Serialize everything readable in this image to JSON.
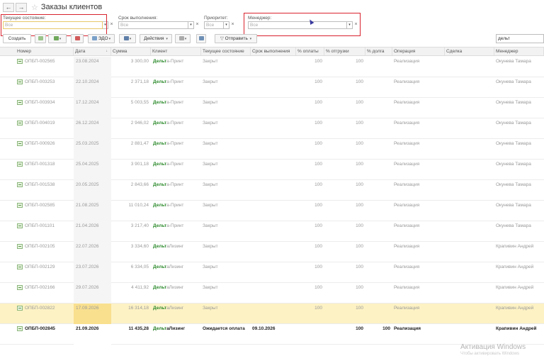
{
  "window": {
    "title": "Заказы клиентов",
    "back": "←",
    "forward": "→",
    "star": "☆"
  },
  "filters": {
    "state": {
      "label": "Текущее состояние:",
      "placeholder": "Все"
    },
    "due": {
      "label": "Срок выполнения:",
      "placeholder": "Все"
    },
    "priority": {
      "label": "Приоритет:",
      "placeholder": "Все"
    },
    "manager": {
      "label": "Менеджер:",
      "placeholder": "Все"
    },
    "clear": "×",
    "dropdown": "▾"
  },
  "toolbar": {
    "create": "Создать",
    "edo": "ЭДО",
    "actions": "Действия",
    "send": "Отправить",
    "search_value": "дельт",
    "caret": "▾"
  },
  "table": {
    "headers": [
      "Номер",
      "Дата",
      "Сумма",
      "Клиент",
      "Текущее состояние",
      "Срок выполнения",
      "% оплаты",
      "% отгрузки",
      "% долга",
      "Операция",
      "Сделка",
      "Менеджер"
    ],
    "sort_indicator": "↓",
    "rows": [
      {
        "number": "ОПБП-002565",
        "date": "23.08.2024",
        "sum": "3 300,00",
        "client_hl": "Дельт",
        "client_rest": "а-Принт",
        "state": "Закрыт",
        "due": "",
        "paid": "100",
        "shipped": "100",
        "debt": "",
        "operation": "Реализация",
        "deal": "",
        "manager": "Окунева Тамара"
      },
      {
        "number": "ОПБП-003253",
        "date": "22.10.2024",
        "sum": "2 371,18",
        "client_hl": "Дельт",
        "client_rest": "а-Принт",
        "state": "Закрыт",
        "due": "",
        "paid": "100",
        "shipped": "100",
        "debt": "",
        "operation": "Реализация",
        "deal": "",
        "manager": "Окунева Тамара"
      },
      {
        "number": "ОПБП-003934",
        "date": "17.12.2024",
        "sum": "5 003,55",
        "client_hl": "Дельт",
        "client_rest": "а-Принт",
        "state": "Закрыт",
        "due": "",
        "paid": "100",
        "shipped": "100",
        "debt": "",
        "operation": "Реализация",
        "deal": "",
        "manager": "Окунева Тамара"
      },
      {
        "number": "ОПБП-004019",
        "date": "26.12.2024",
        "sum": "2 946,02",
        "client_hl": "Дельт",
        "client_rest": "а-Принт",
        "state": "Закрыт",
        "due": "",
        "paid": "100",
        "shipped": "100",
        "debt": "",
        "operation": "Реализация",
        "deal": "",
        "manager": "Окунева Тамара"
      },
      {
        "number": "ОПБП-000926",
        "date": "25.03.2025",
        "sum": "2 881,47",
        "client_hl": "Дельт",
        "client_rest": "а-Принт",
        "state": "Закрыт",
        "due": "",
        "paid": "100",
        "shipped": "100",
        "debt": "",
        "operation": "Реализация",
        "deal": "",
        "manager": "Окунева Тамара"
      },
      {
        "number": "ОПБП-001318",
        "date": "25.04.2025",
        "sum": "3 901,18",
        "client_hl": "Дельт",
        "client_rest": "а-Принт",
        "state": "Закрыт",
        "due": "",
        "paid": "100",
        "shipped": "100",
        "debt": "",
        "operation": "Реализация",
        "deal": "",
        "manager": "Окунева Тамара"
      },
      {
        "number": "ОПБП-001538",
        "date": "20.05.2025",
        "sum": "2 843,66",
        "client_hl": "Дельт",
        "client_rest": "а-Принт",
        "state": "Закрыт",
        "due": "",
        "paid": "100",
        "shipped": "100",
        "debt": "",
        "operation": "Реализация",
        "deal": "",
        "manager": "Окунева Тамара"
      },
      {
        "number": "ОПБП-002585",
        "date": "21.08.2025",
        "sum": "11 010,24",
        "client_hl": "Дельт",
        "client_rest": "а-Принт",
        "state": "Закрыт",
        "due": "",
        "paid": "100",
        "shipped": "100",
        "debt": "",
        "operation": "Реализация",
        "deal": "",
        "manager": "Окунева Тамара"
      },
      {
        "number": "ОПБП-001101",
        "date": "21.04.2026",
        "sum": "3 217,40",
        "client_hl": "Дельт",
        "client_rest": "а-Принт",
        "state": "Закрыт",
        "due": "",
        "paid": "100",
        "shipped": "100",
        "debt": "",
        "operation": "Реализация",
        "deal": "",
        "manager": "Окунева Тамара"
      },
      {
        "number": "ОПБП-002105",
        "date": "22.07.2026",
        "sum": "3 334,60",
        "client_hl": "Дельт",
        "client_rest": "аЛизинг",
        "state": "Закрыт",
        "due": "",
        "paid": "100",
        "shipped": "100",
        "debt": "",
        "operation": "Реализация",
        "deal": "",
        "manager": "Крапивин Андрей"
      },
      {
        "number": "ОПБП-002129",
        "date": "23.07.2026",
        "sum": "6 334,05",
        "client_hl": "Дельт",
        "client_rest": "аЛизинг",
        "state": "Закрыт",
        "due": "",
        "paid": "100",
        "shipped": "100",
        "debt": "",
        "operation": "Реализация",
        "deal": "",
        "manager": "Крапивин Андрей"
      },
      {
        "number": "ОПБП-002166",
        "date": "29.07.2026",
        "sum": "4 411,92",
        "client_hl": "Дельт",
        "client_rest": "аЛизинг",
        "state": "Закрыт",
        "due": "",
        "paid": "100",
        "shipped": "100",
        "debt": "",
        "operation": "Реализация",
        "deal": "",
        "manager": "Крапивин Андрей"
      },
      {
        "number": "ОПБП-002822",
        "date": "17.09.2026",
        "sum": "16 314,18",
        "client_hl": "Дельт",
        "client_rest": "аЛизинг",
        "state": "Закрыт",
        "due": "",
        "paid": "100",
        "shipped": "100",
        "debt": "",
        "operation": "Реализация",
        "deal": "",
        "manager": "Крапивин Андрей"
      },
      {
        "number": "ОПБП-002845",
        "date": "21.09.2026",
        "sum": "11 435,28",
        "client_hl": "Дельт",
        "client_rest": "аЛизинг",
        "state": "Ожидается оплата",
        "due": "09.10.2026",
        "paid": "",
        "shipped": "100",
        "debt": "100",
        "operation": "Реализация",
        "deal": "",
        "manager": "Крапивин Андрей"
      }
    ]
  },
  "watermark": {
    "title": "Активация Windows",
    "sub": "Чтобы активировать Windows"
  },
  "colors": {
    "highlight_box": "#d9232e",
    "client_match": "#2c8a2c",
    "selected_row": "#fdf2c4"
  }
}
